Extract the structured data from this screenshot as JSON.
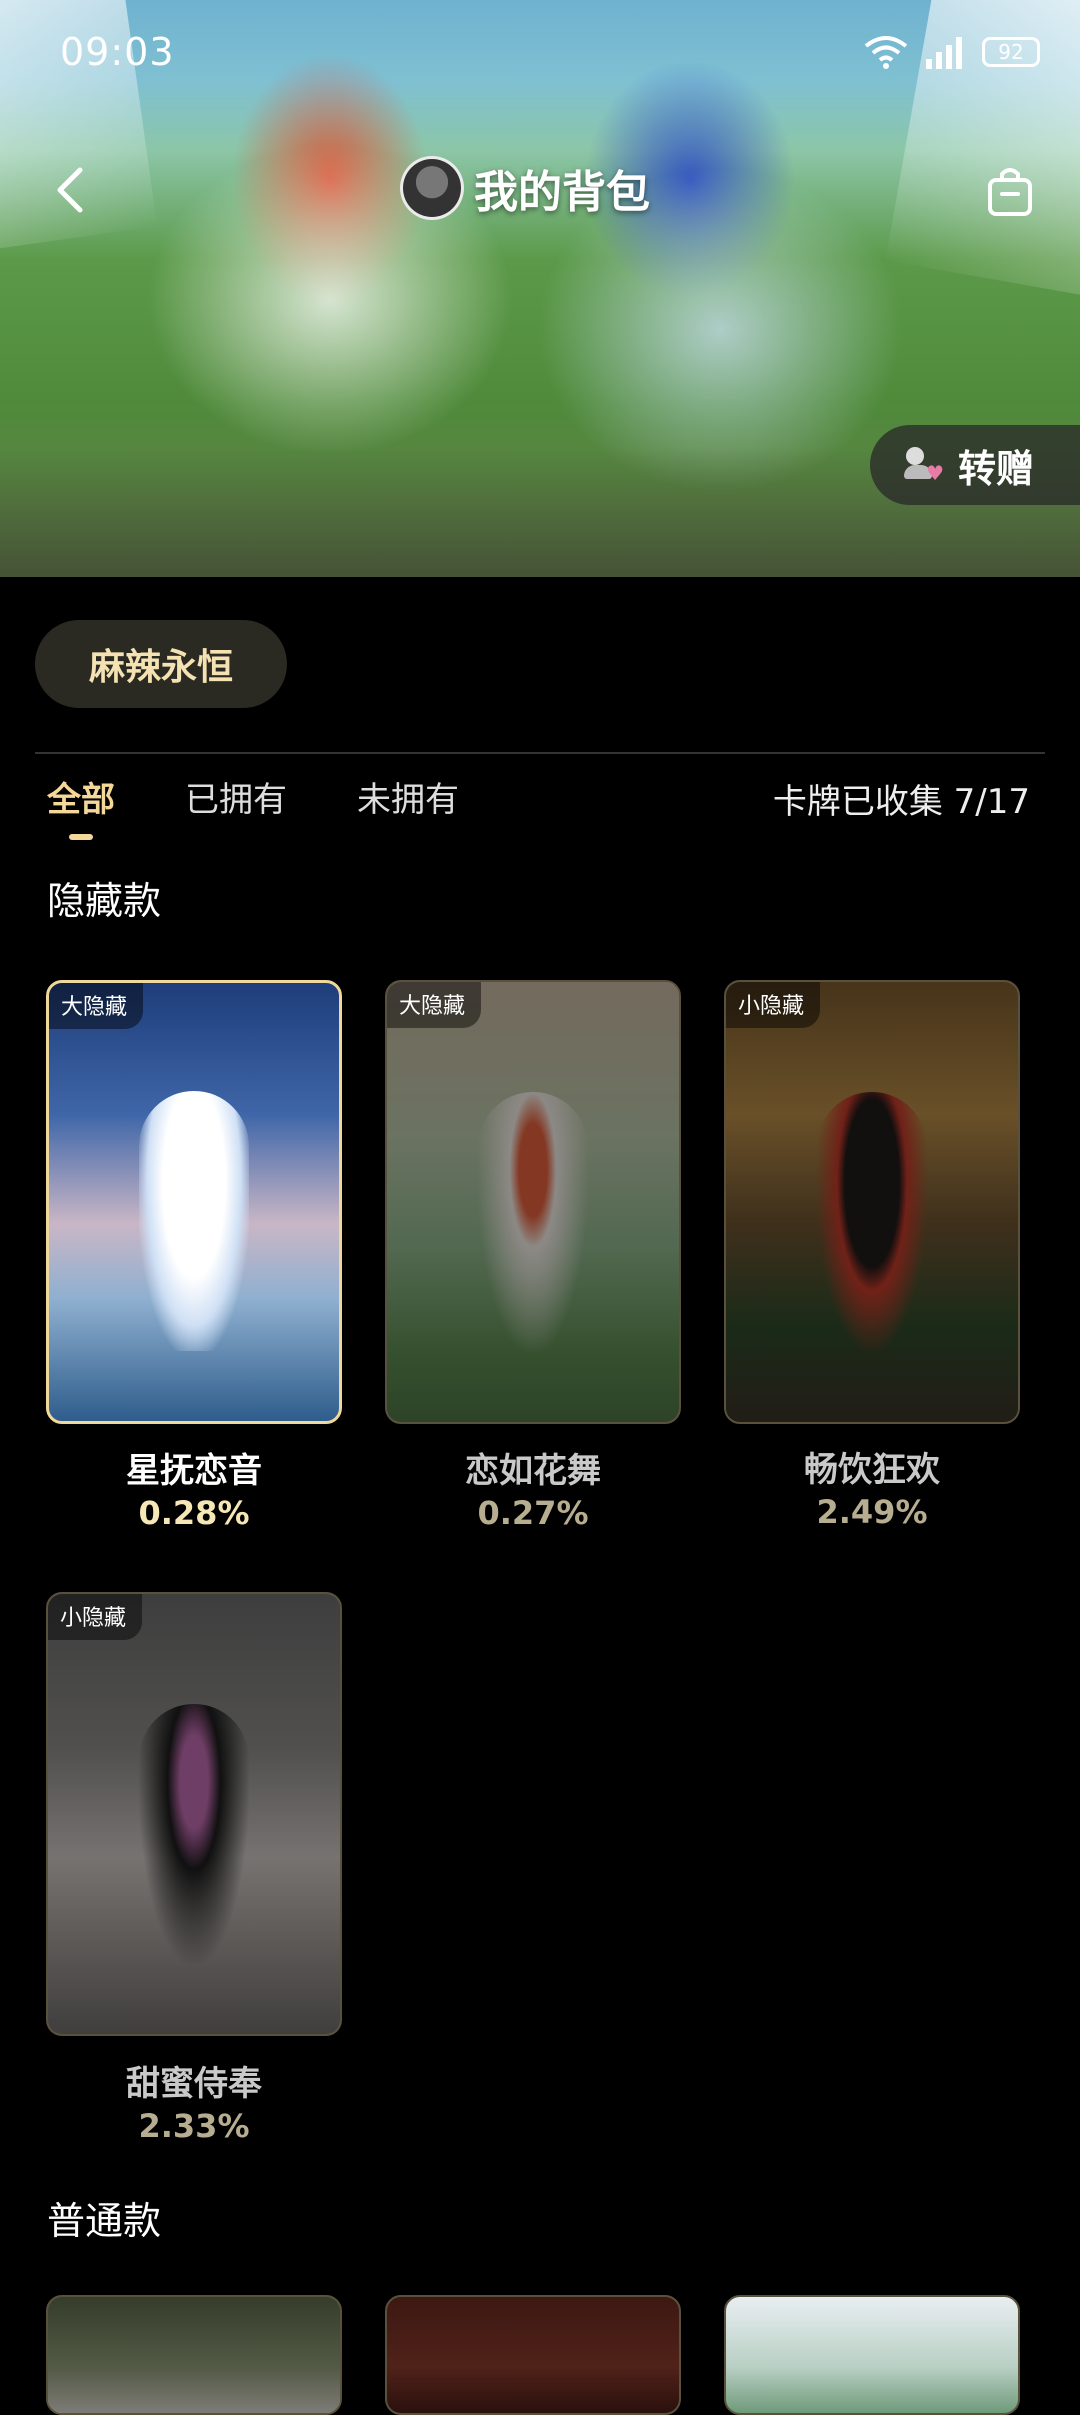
{
  "status_bar": {
    "time": "09:03",
    "battery": "92"
  },
  "header": {
    "title": "我的背包",
    "gift_label": "转赠"
  },
  "series": {
    "name": "麻辣永恒"
  },
  "tabs": [
    {
      "label": "全部",
      "active": true
    },
    {
      "label": "已拥有",
      "active": false
    },
    {
      "label": "未拥有",
      "active": false
    }
  ],
  "collection_status": "卡牌已收集 7/17",
  "sections": [
    {
      "title": "隐藏款",
      "cards": [
        {
          "badge": "大隐藏",
          "name": "星抚恋音",
          "rate": "0.28%",
          "owned": true
        },
        {
          "badge": "大隐藏",
          "name": "恋如花舞",
          "rate": "0.27%",
          "owned": false
        },
        {
          "badge": "小隐藏",
          "name": "畅饮狂欢",
          "rate": "2.49%",
          "owned": false
        },
        {
          "badge": "小隐藏",
          "name": "甜蜜侍奉",
          "rate": "2.33%",
          "owned": false
        }
      ]
    },
    {
      "title": "普通款"
    }
  ],
  "colors": {
    "accent": "#f4d89a",
    "chip_bg": "#2b2a22",
    "background": "#000000"
  }
}
